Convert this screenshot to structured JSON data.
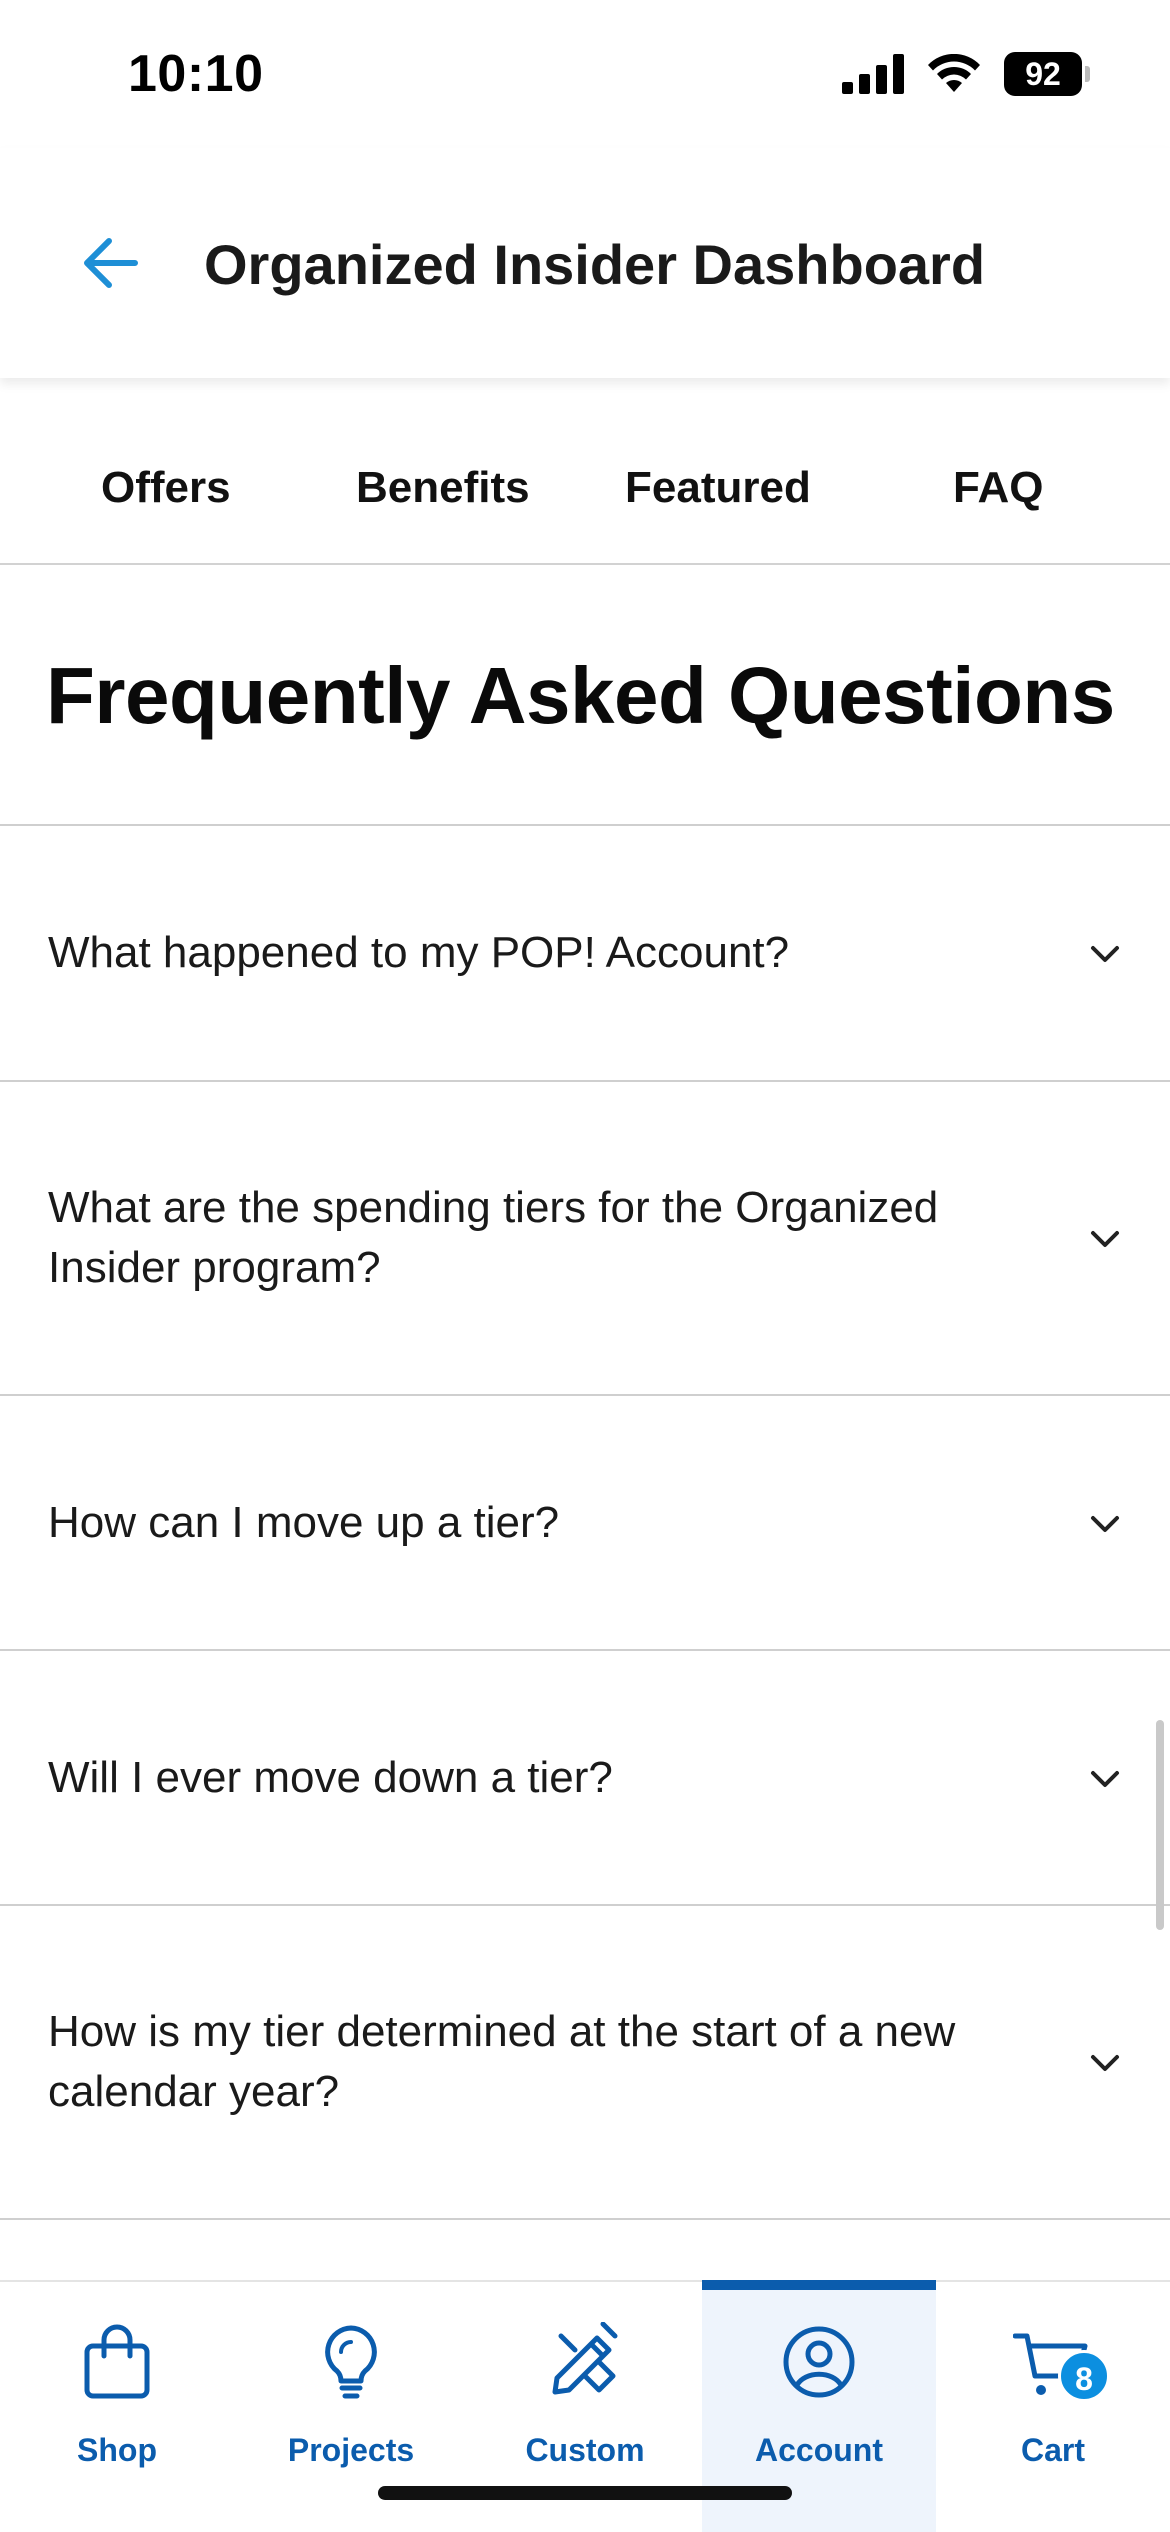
{
  "status_bar": {
    "time": "10:10",
    "battery": "92",
    "icons": [
      "cellular-signal-icon",
      "wifi-icon",
      "battery-icon"
    ]
  },
  "header": {
    "title": "Organized Insider Dashboard",
    "back_icon": "back-arrow-icon",
    "accent_color": "#1e8fd6"
  },
  "tabs": [
    {
      "label": "Offers"
    },
    {
      "label": "Benefits"
    },
    {
      "label": "Featured"
    },
    {
      "label": "FAQ"
    }
  ],
  "faq": {
    "title": "Frequently Asked Questions",
    "items": [
      {
        "question": "What happened to my POP! Account?"
      },
      {
        "question": "What are the spending tiers for the Organized Insider program?"
      },
      {
        "question": "How can I move up a tier?"
      },
      {
        "question": "Will I ever move down a tier?"
      },
      {
        "question": "How is my tier determined at the start of a new calendar year?"
      }
    ]
  },
  "bottom_nav": {
    "items": [
      {
        "label": "Shop",
        "icon": "shopping-bag-icon"
      },
      {
        "label": "Projects",
        "icon": "lightbulb-icon"
      },
      {
        "label": "Custom",
        "icon": "pencil-ruler-icon"
      },
      {
        "label": "Account",
        "icon": "account-icon",
        "active": true
      },
      {
        "label": "Cart",
        "icon": "cart-icon",
        "badge": "8"
      }
    ],
    "color": "#0b5cad"
  }
}
